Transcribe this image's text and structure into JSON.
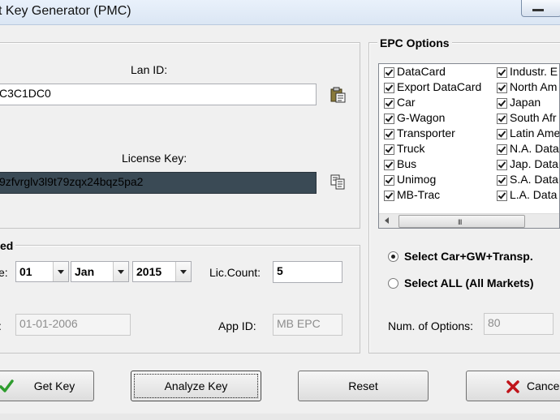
{
  "window": {
    "title": "t Key Generator (PMC)"
  },
  "license_panel": {
    "lan_id_label": "Lan ID:",
    "lan_id_value": "C3C1DC0",
    "license_key_label": "License Key:",
    "license_key_value": "9zfvrglv3l9t79zqx24bqz5pa2"
  },
  "date_panel": {
    "legend": "ed",
    "date_label": "e:",
    "day": "01",
    "month": "Jan",
    "year": "2015",
    "lic_count_label": "Lic.Count:",
    "lic_count_value": "5",
    "start_label": ":",
    "start_date": "01-01-2006",
    "app_id_label": "App ID:",
    "app_id_value": "MB EPC"
  },
  "epc": {
    "legend": "EPC Options",
    "col1": [
      "DataCard",
      "Export DataCard",
      "Car",
      "G-Wagon",
      "Transporter",
      "Truck",
      "Bus",
      "Unimog",
      "MB-Trac"
    ],
    "col2": [
      "Industr. E",
      "North Am",
      "Japan",
      "South Afr",
      "Latin Ame",
      "N.A. Data",
      "Jap. Data",
      "S.A. Data",
      "L.A. Data"
    ],
    "scroll_grip": "III",
    "radio_car": "Select Car+GW+Transp.",
    "radio_all": "Select ALL (All Markets)",
    "num_options_label": "Num. of Options:",
    "num_options_value": "80"
  },
  "buttons": {
    "get_key": "Get Key",
    "analyze_key": "Analyze Key",
    "reset": "Reset",
    "cancel": "Cancel"
  }
}
